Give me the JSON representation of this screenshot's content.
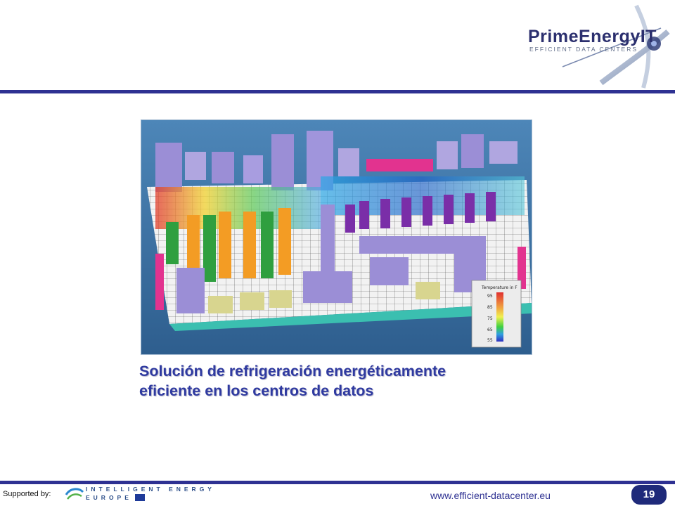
{
  "brand": {
    "name": "PrimeEnergyIT",
    "tagline": "EFFICIENT DATA CENTERS"
  },
  "figure": {
    "legend": {
      "title": "Temperature in F",
      "ticks": [
        "95",
        "85",
        "75",
        "65",
        "55"
      ]
    }
  },
  "caption": {
    "line1": "Solución de refrigeración energéticamente",
    "line2": "eficiente en los centros de datos"
  },
  "footer": {
    "supported_label": "Supported by:",
    "sponsor_line1": "INTELLIGENT ENERGY",
    "sponsor_line2": "EUROPE",
    "url": "www.efficient-datacenter.eu",
    "page_number": "19"
  },
  "colors": {
    "rule": "#2e3192",
    "caption": "#2f3aa0",
    "page_badge": "#1f2a7a"
  }
}
